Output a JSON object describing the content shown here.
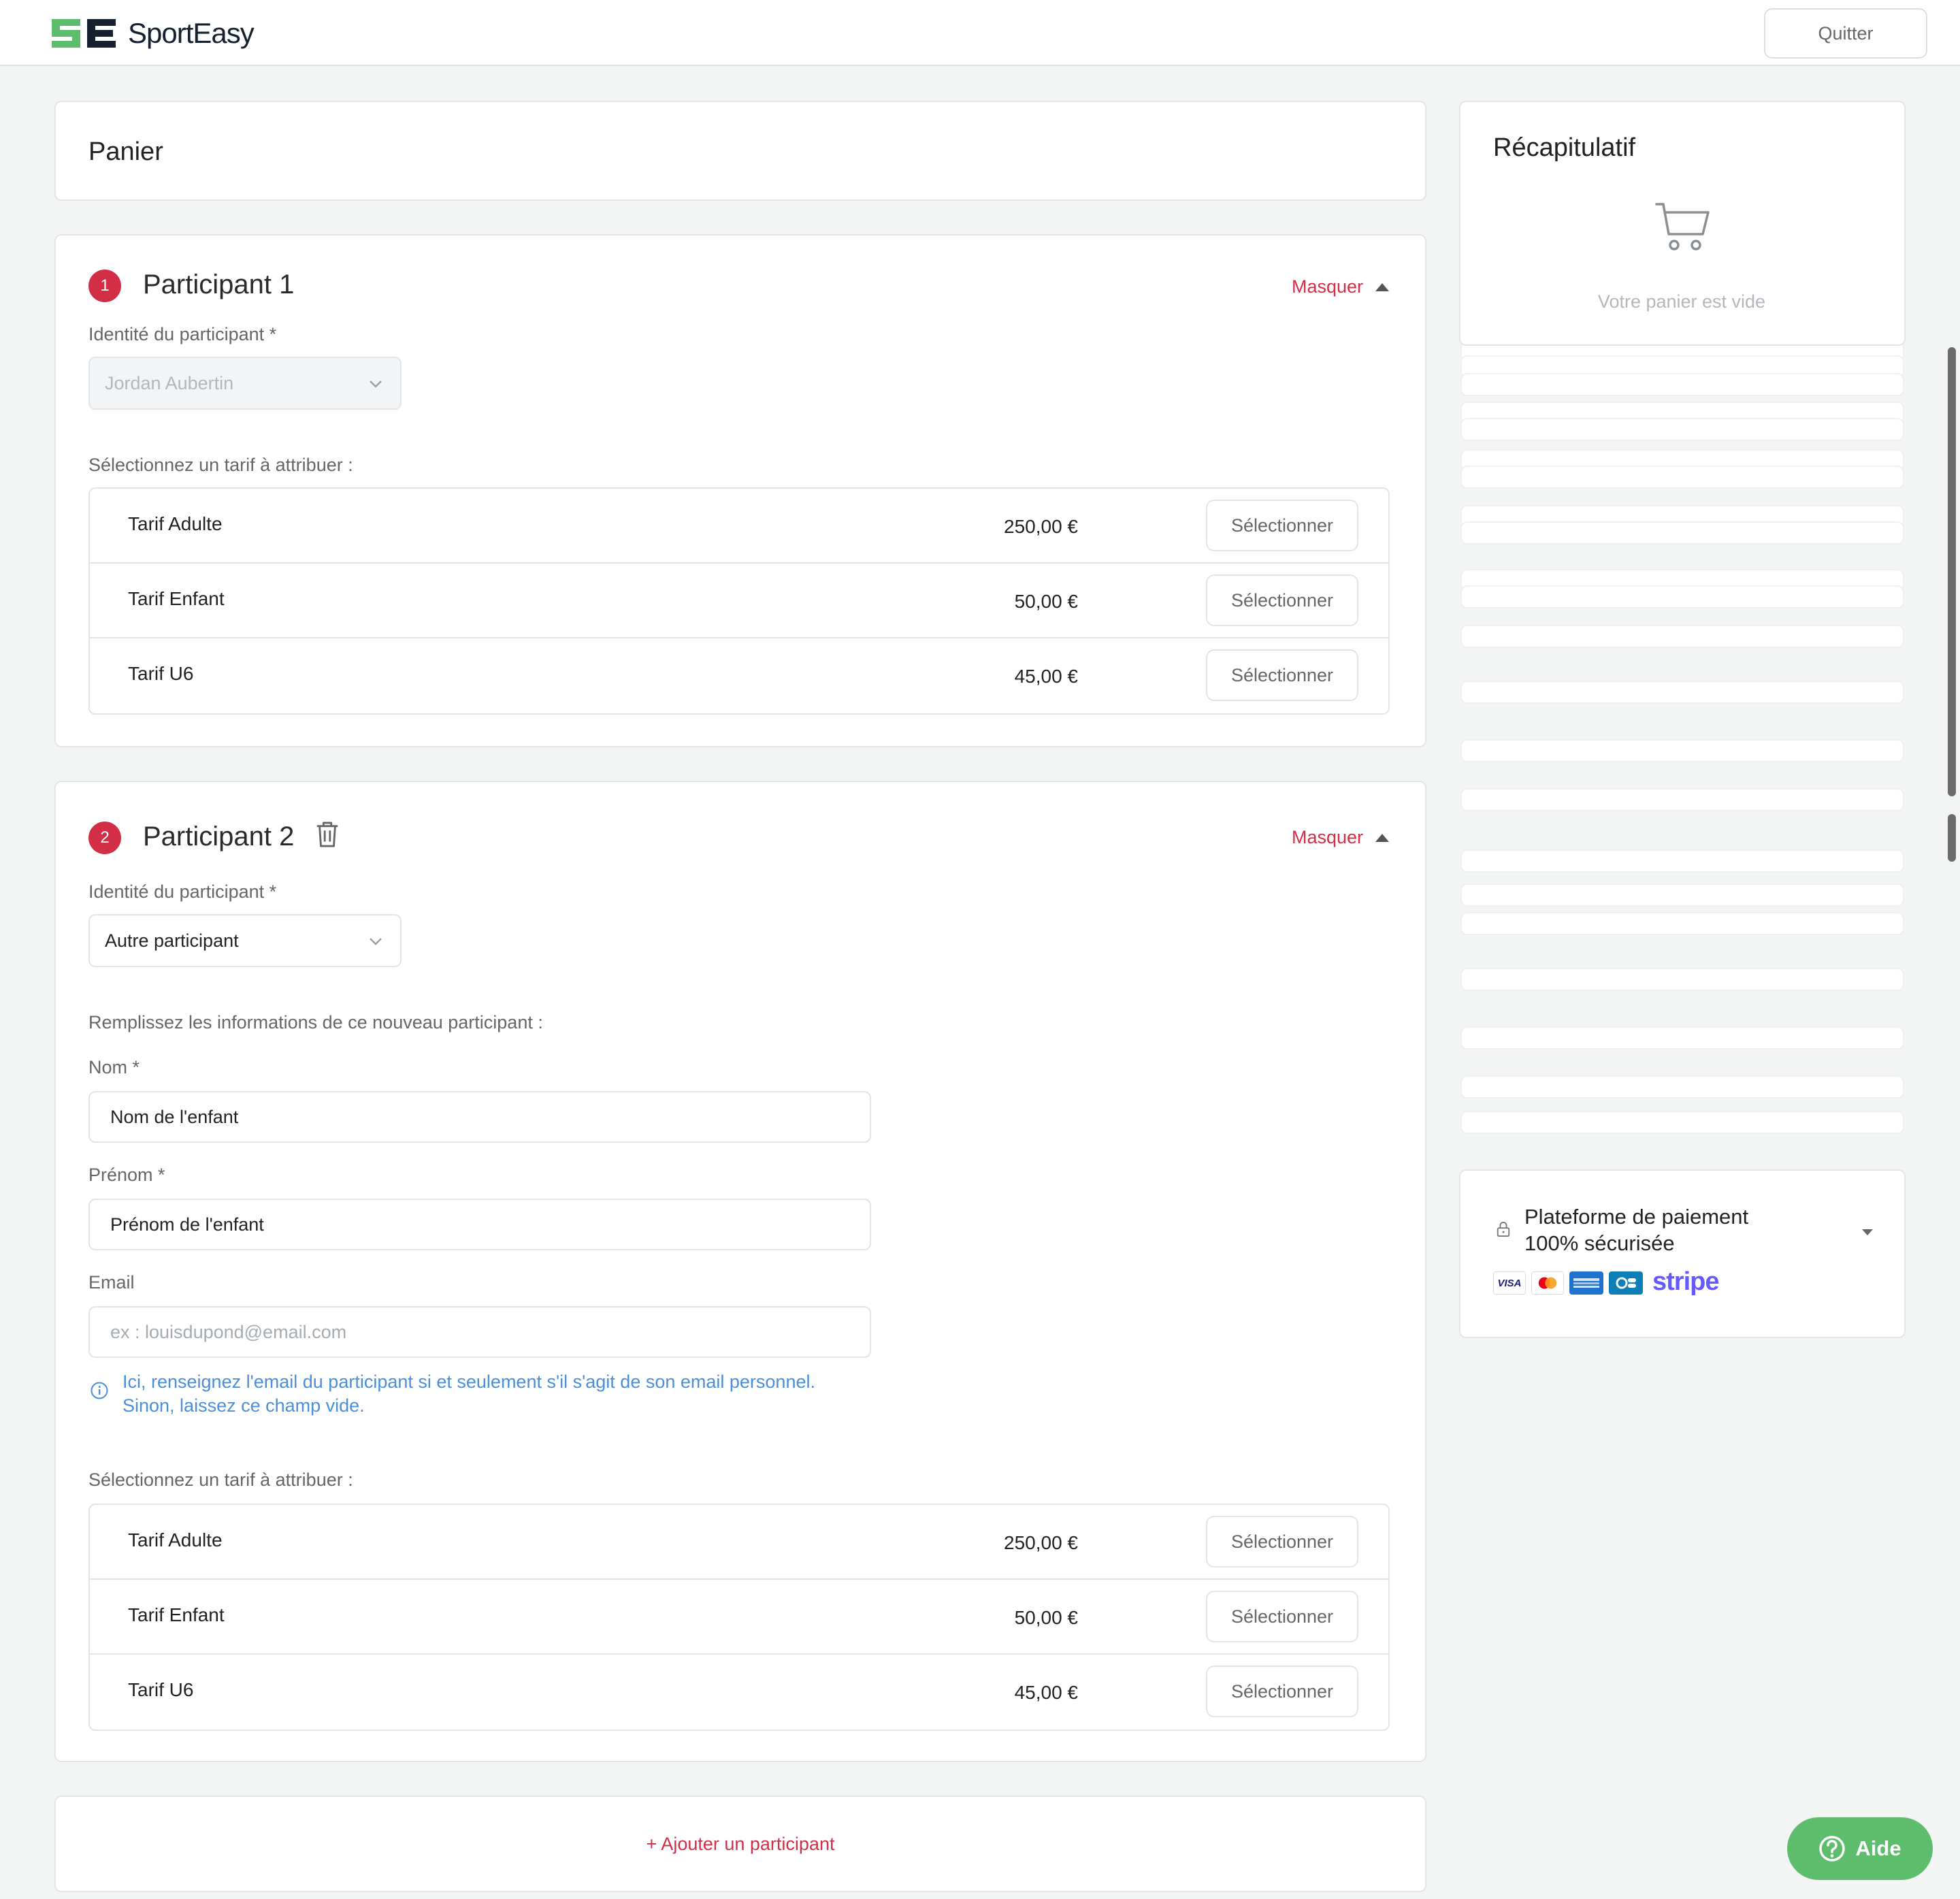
{
  "header": {
    "logo_text": "SportEasy",
    "quit_label": "Quitter"
  },
  "cart": {
    "title": "Panier"
  },
  "participants": [
    {
      "number": "1",
      "title": "Participant 1",
      "toggle_label": "Masquer",
      "identity_label": "Identité du participant *",
      "identity_value": "Jordan Aubertin",
      "tariff_prompt": "Sélectionnez un tarif à attribuer :",
      "tariffs": [
        {
          "name": "Tarif Adulte",
          "price": "250,00 €",
          "button": "Sélectionner"
        },
        {
          "name": "Tarif Enfant",
          "price": "50,00 €",
          "button": "Sélectionner"
        },
        {
          "name": "Tarif U6",
          "price": "45,00 €",
          "button": "Sélectionner"
        }
      ]
    },
    {
      "number": "2",
      "title": "Participant 2",
      "toggle_label": "Masquer",
      "identity_label": "Identité du participant *",
      "identity_value": "Autre participant",
      "fill_prompt": "Remplissez les informations de ce nouveau participant :",
      "fields": {
        "nom_label": "Nom *",
        "nom_value": "Nom de l'enfant",
        "prenom_label": "Prénom *",
        "prenom_value": "Prénom de l'enfant",
        "email_label": "Email",
        "email_placeholder": "ex : louisdupond@email.com"
      },
      "email_info_line1": "Ici, renseignez l'email du participant si et seulement s'il s'agit de son email personnel.",
      "email_info_line2": "Sinon, laissez ce champ vide.",
      "tariff_prompt": "Sélectionnez un tarif à attribuer :",
      "tariffs": [
        {
          "name": "Tarif Adulte",
          "price": "250,00 €",
          "button": "Sélectionner"
        },
        {
          "name": "Tarif Enfant",
          "price": "50,00 €",
          "button": "Sélectionner"
        },
        {
          "name": "Tarif U6",
          "price": "45,00 €",
          "button": "Sélectionner"
        }
      ]
    }
  ],
  "add_participant_label": "+ Ajouter un participant",
  "summary": {
    "title": "Récapitulatif",
    "empty_text": "Votre panier est vide"
  },
  "payment": {
    "line1": "Plateforme de paiement",
    "line2": "100% sécurisée",
    "card_brands": [
      "visa",
      "mastercard",
      "amex",
      "cb"
    ],
    "provider": "stripe"
  },
  "help": {
    "label": "Aide"
  },
  "colors": {
    "accent_red": "#d22e45",
    "brand_green": "#5ebd6d",
    "info_blue": "#4a8fd8",
    "stripe_purple": "#635bff"
  }
}
